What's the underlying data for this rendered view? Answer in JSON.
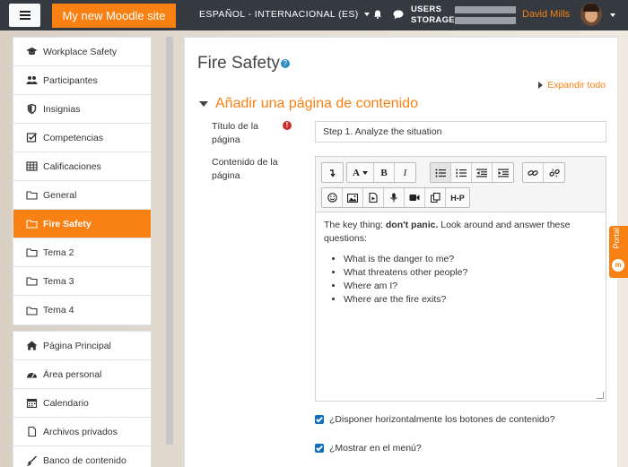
{
  "navbar": {
    "site_name": "My new Moodle site",
    "language": "ESPAÑOL - INTERNACIONAL (ES)",
    "storage_line1": "USERS",
    "storage_line2": "STORAGE",
    "username": "David Mills"
  },
  "sidebar": {
    "course_items": [
      {
        "label": "Workplace Safety",
        "icon": "graduation-cap-icon"
      },
      {
        "label": "Participantes",
        "icon": "users-icon"
      },
      {
        "label": "Insignias",
        "icon": "shield-icon"
      },
      {
        "label": "Competencias",
        "icon": "check-square-icon"
      },
      {
        "label": "Calificaciones",
        "icon": "table-icon"
      },
      {
        "label": "General",
        "icon": "folder-icon"
      },
      {
        "label": "Fire Safety",
        "icon": "folder-icon",
        "active": true
      },
      {
        "label": "Tema 2",
        "icon": "folder-icon"
      },
      {
        "label": "Tema 3",
        "icon": "folder-icon"
      },
      {
        "label": "Tema 4",
        "icon": "folder-icon"
      }
    ],
    "site_items": [
      {
        "label": "Página Principal",
        "icon": "home-icon"
      },
      {
        "label": "Área personal",
        "icon": "dashboard-icon"
      },
      {
        "label": "Calendario",
        "icon": "calendar-icon"
      },
      {
        "label": "Archivos privados",
        "icon": "file-icon"
      },
      {
        "label": "Banco de contenido",
        "icon": "paintbrush-icon"
      }
    ]
  },
  "main": {
    "page_title": "Fire Safety",
    "expand_all": "Expandir todo",
    "section_title": "Añadir una página de contenido",
    "title_label": "Título de la página",
    "title_value": "Step 1. Analyze the situation",
    "content_label": "Contenido de la página",
    "editor": {
      "intro_prefix": "The key thing: ",
      "intro_bold": "don't panic.",
      "intro_suffix": " Look around and answer these questions:",
      "list": [
        "What is the danger to me?",
        "What threatens other people?",
        "Where am I?",
        "Where are the fire exits?"
      ]
    },
    "checkbox1": "¿Disponer horizontalmente los botones de contenido?",
    "checkbox2": "¿Mostrar en el menú?"
  },
  "portal_tab": {
    "label": "Portal",
    "badge": "m"
  },
  "colors": {
    "accent": "#f98012",
    "navbar": "#343a40",
    "checkbox": "#0f6cbf"
  }
}
